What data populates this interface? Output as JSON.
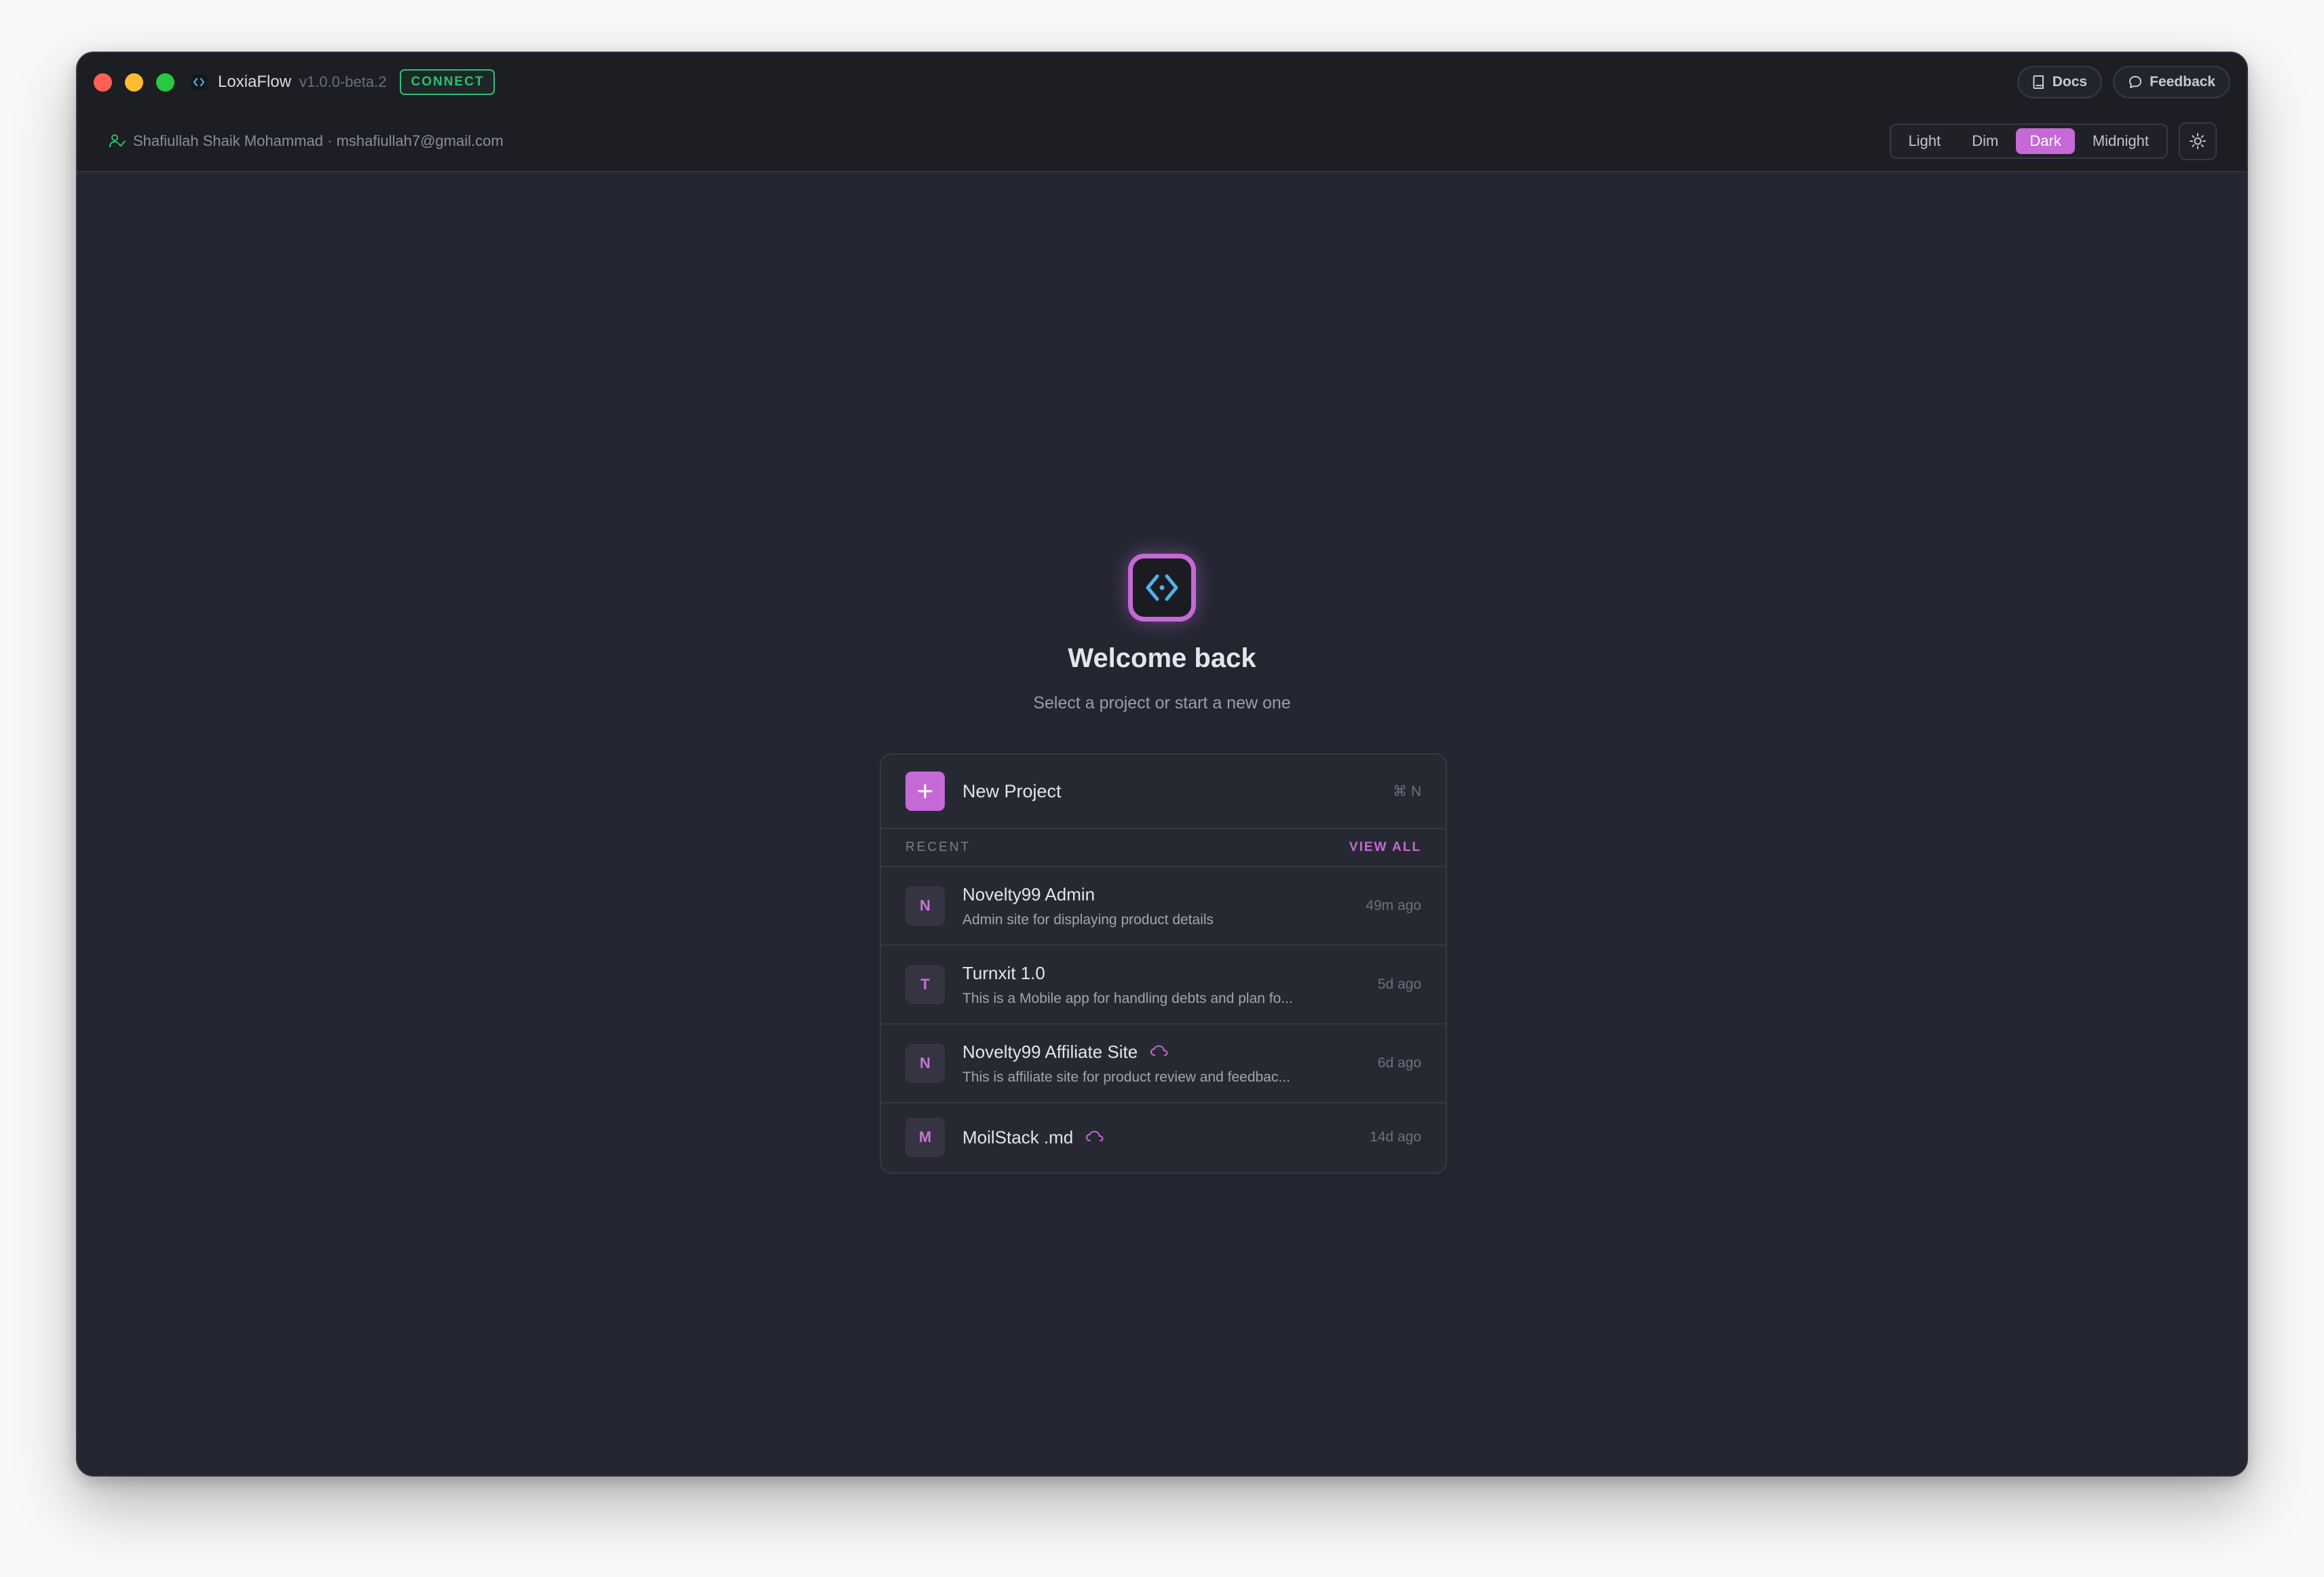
{
  "app": {
    "name": "LoxiaFlow",
    "version": "v1.0.0-beta.2",
    "connect_badge": "CONNECT"
  },
  "titlebar": {
    "docs_label": "Docs",
    "feedback_label": "Feedback"
  },
  "user": {
    "display": "Shafiullah Shaik Mohammad · mshafiullah7@gmail.com"
  },
  "themes": {
    "options": [
      "Light",
      "Dim",
      "Dark",
      "Midnight"
    ],
    "selected": "Dark"
  },
  "welcome": {
    "title": "Welcome back",
    "subtitle": "Select a project or start a new one"
  },
  "new_project": {
    "label": "New Project",
    "shortcut": "⌘ N"
  },
  "recent": {
    "label": "RECENT",
    "view_all": "VIEW ALL",
    "projects": [
      {
        "initial": "N",
        "name": "Novelty99 Admin",
        "description": "Admin site for displaying product details",
        "time": "49m ago",
        "cloud": false
      },
      {
        "initial": "T",
        "name": "Turnxit 1.0",
        "description": "This is a Mobile app for handling debts and plan fo...",
        "time": "5d ago",
        "cloud": false
      },
      {
        "initial": "N",
        "name": "Novelty99 Affiliate Site",
        "description": "This is affiliate site for product review and feedbac...",
        "time": "6d ago",
        "cloud": true
      },
      {
        "initial": "M",
        "name": "MoilStack .md",
        "description": "",
        "time": "14d ago",
        "cloud": true
      }
    ]
  },
  "colors": {
    "accent": "#c469d6",
    "connect_green": "#2fbf71",
    "window_bg": "#232631",
    "chrome_bg": "#1c1e23"
  }
}
